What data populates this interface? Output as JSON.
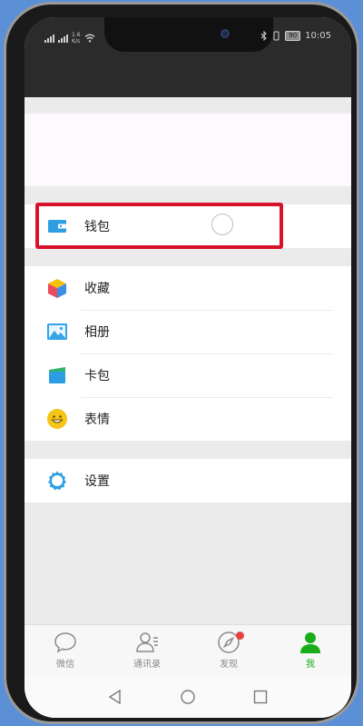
{
  "status_bar": {
    "net_speed": "1.6\nK/s",
    "time": "10:05",
    "battery": "90"
  },
  "section_wallet": {
    "items": [
      {
        "label": "钱包",
        "icon": "wallet-icon"
      }
    ]
  },
  "section_main": {
    "items": [
      {
        "label": "收藏",
        "icon": "favorites-cube-icon"
      },
      {
        "label": "相册",
        "icon": "album-icon"
      },
      {
        "label": "卡包",
        "icon": "card-wallet-icon"
      },
      {
        "label": "表情",
        "icon": "smiley-icon"
      }
    ]
  },
  "section_settings": {
    "items": [
      {
        "label": "设置",
        "icon": "gear-icon"
      }
    ]
  },
  "tabbar": {
    "tabs": [
      {
        "label": "微信",
        "icon": "chat-bubble-icon"
      },
      {
        "label": "通讯录",
        "icon": "contacts-icon"
      },
      {
        "label": "发现",
        "icon": "compass-icon"
      },
      {
        "label": "我",
        "icon": "person-icon"
      }
    ]
  },
  "colors": {
    "active_tab": "#1aad19",
    "highlight_box": "#d9122c",
    "badge": "#e64340"
  }
}
